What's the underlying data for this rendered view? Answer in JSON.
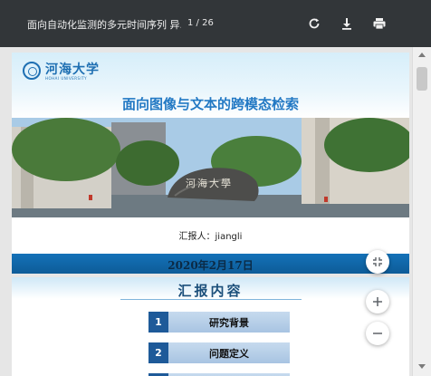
{
  "toolbar": {
    "title": "面向自动化监测的多元时间序列 异...",
    "page_indicator": "1 / 26",
    "icons": {
      "rotate": "rotate-icon",
      "download": "download-icon",
      "print": "print-icon"
    }
  },
  "page1": {
    "logo_cn": "河海大学",
    "logo_en": "HOHAI UNIVERSITY",
    "title": "面向图像与文本的跨模态检索",
    "stone_text": "河海大學",
    "reporter": "汇报人：jiangli",
    "date": "2020年2月17日"
  },
  "page2": {
    "heading": "汇报内容",
    "items": [
      {
        "num": "1",
        "label": "研究背景"
      },
      {
        "num": "2",
        "label": "问题定义"
      }
    ]
  },
  "controls": {
    "fit_icon": "fit-page-icon",
    "zoom_in_icon": "zoom-in-icon",
    "zoom_out_icon": "zoom-out-icon"
  },
  "colors": {
    "toolbar": "#323639",
    "title_blue": "#2379c4",
    "date_bar": "#1472b8",
    "toc_num": "#1e5a99"
  }
}
